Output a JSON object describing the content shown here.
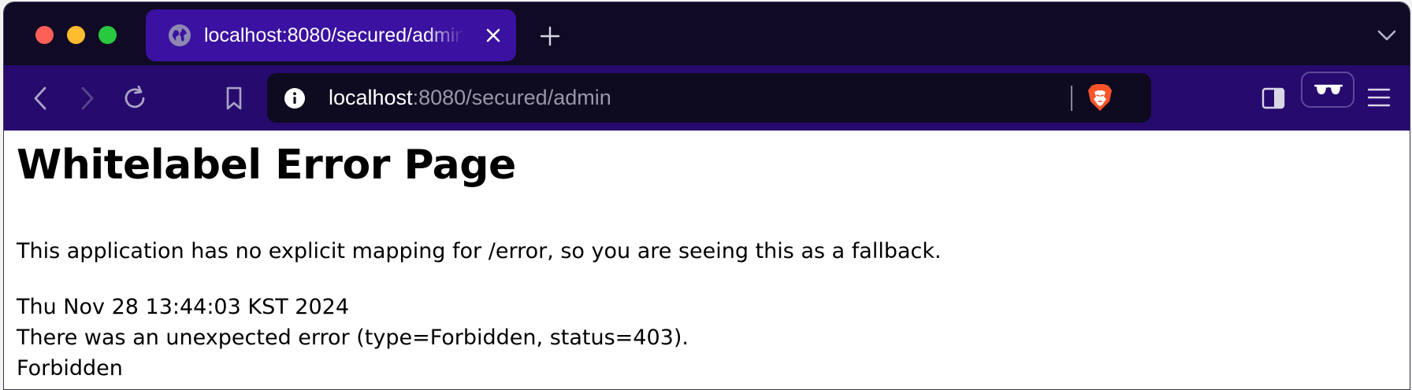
{
  "browser": {
    "tab": {
      "title": "localhost:8080/secured/admin",
      "favicon": "globe-icon"
    },
    "address_bar": {
      "host": "localhost",
      "path": ":8080/secured/admin"
    },
    "colors": {
      "tabbar_bg": "#100a24",
      "active_tab_bg": "#3a11a0",
      "toolbar_bg": "#260a6e",
      "urlbar_bg": "#0e0a20"
    }
  },
  "page": {
    "title": "Whitelabel Error Page",
    "message": "This application has no explicit mapping for /error, so you are seeing this as a fallback.",
    "timestamp": "Thu Nov 28 13:44:03 KST 2024",
    "error_detail": "There was an unexpected error (type=Forbidden, status=403).",
    "error_reason": "Forbidden"
  }
}
